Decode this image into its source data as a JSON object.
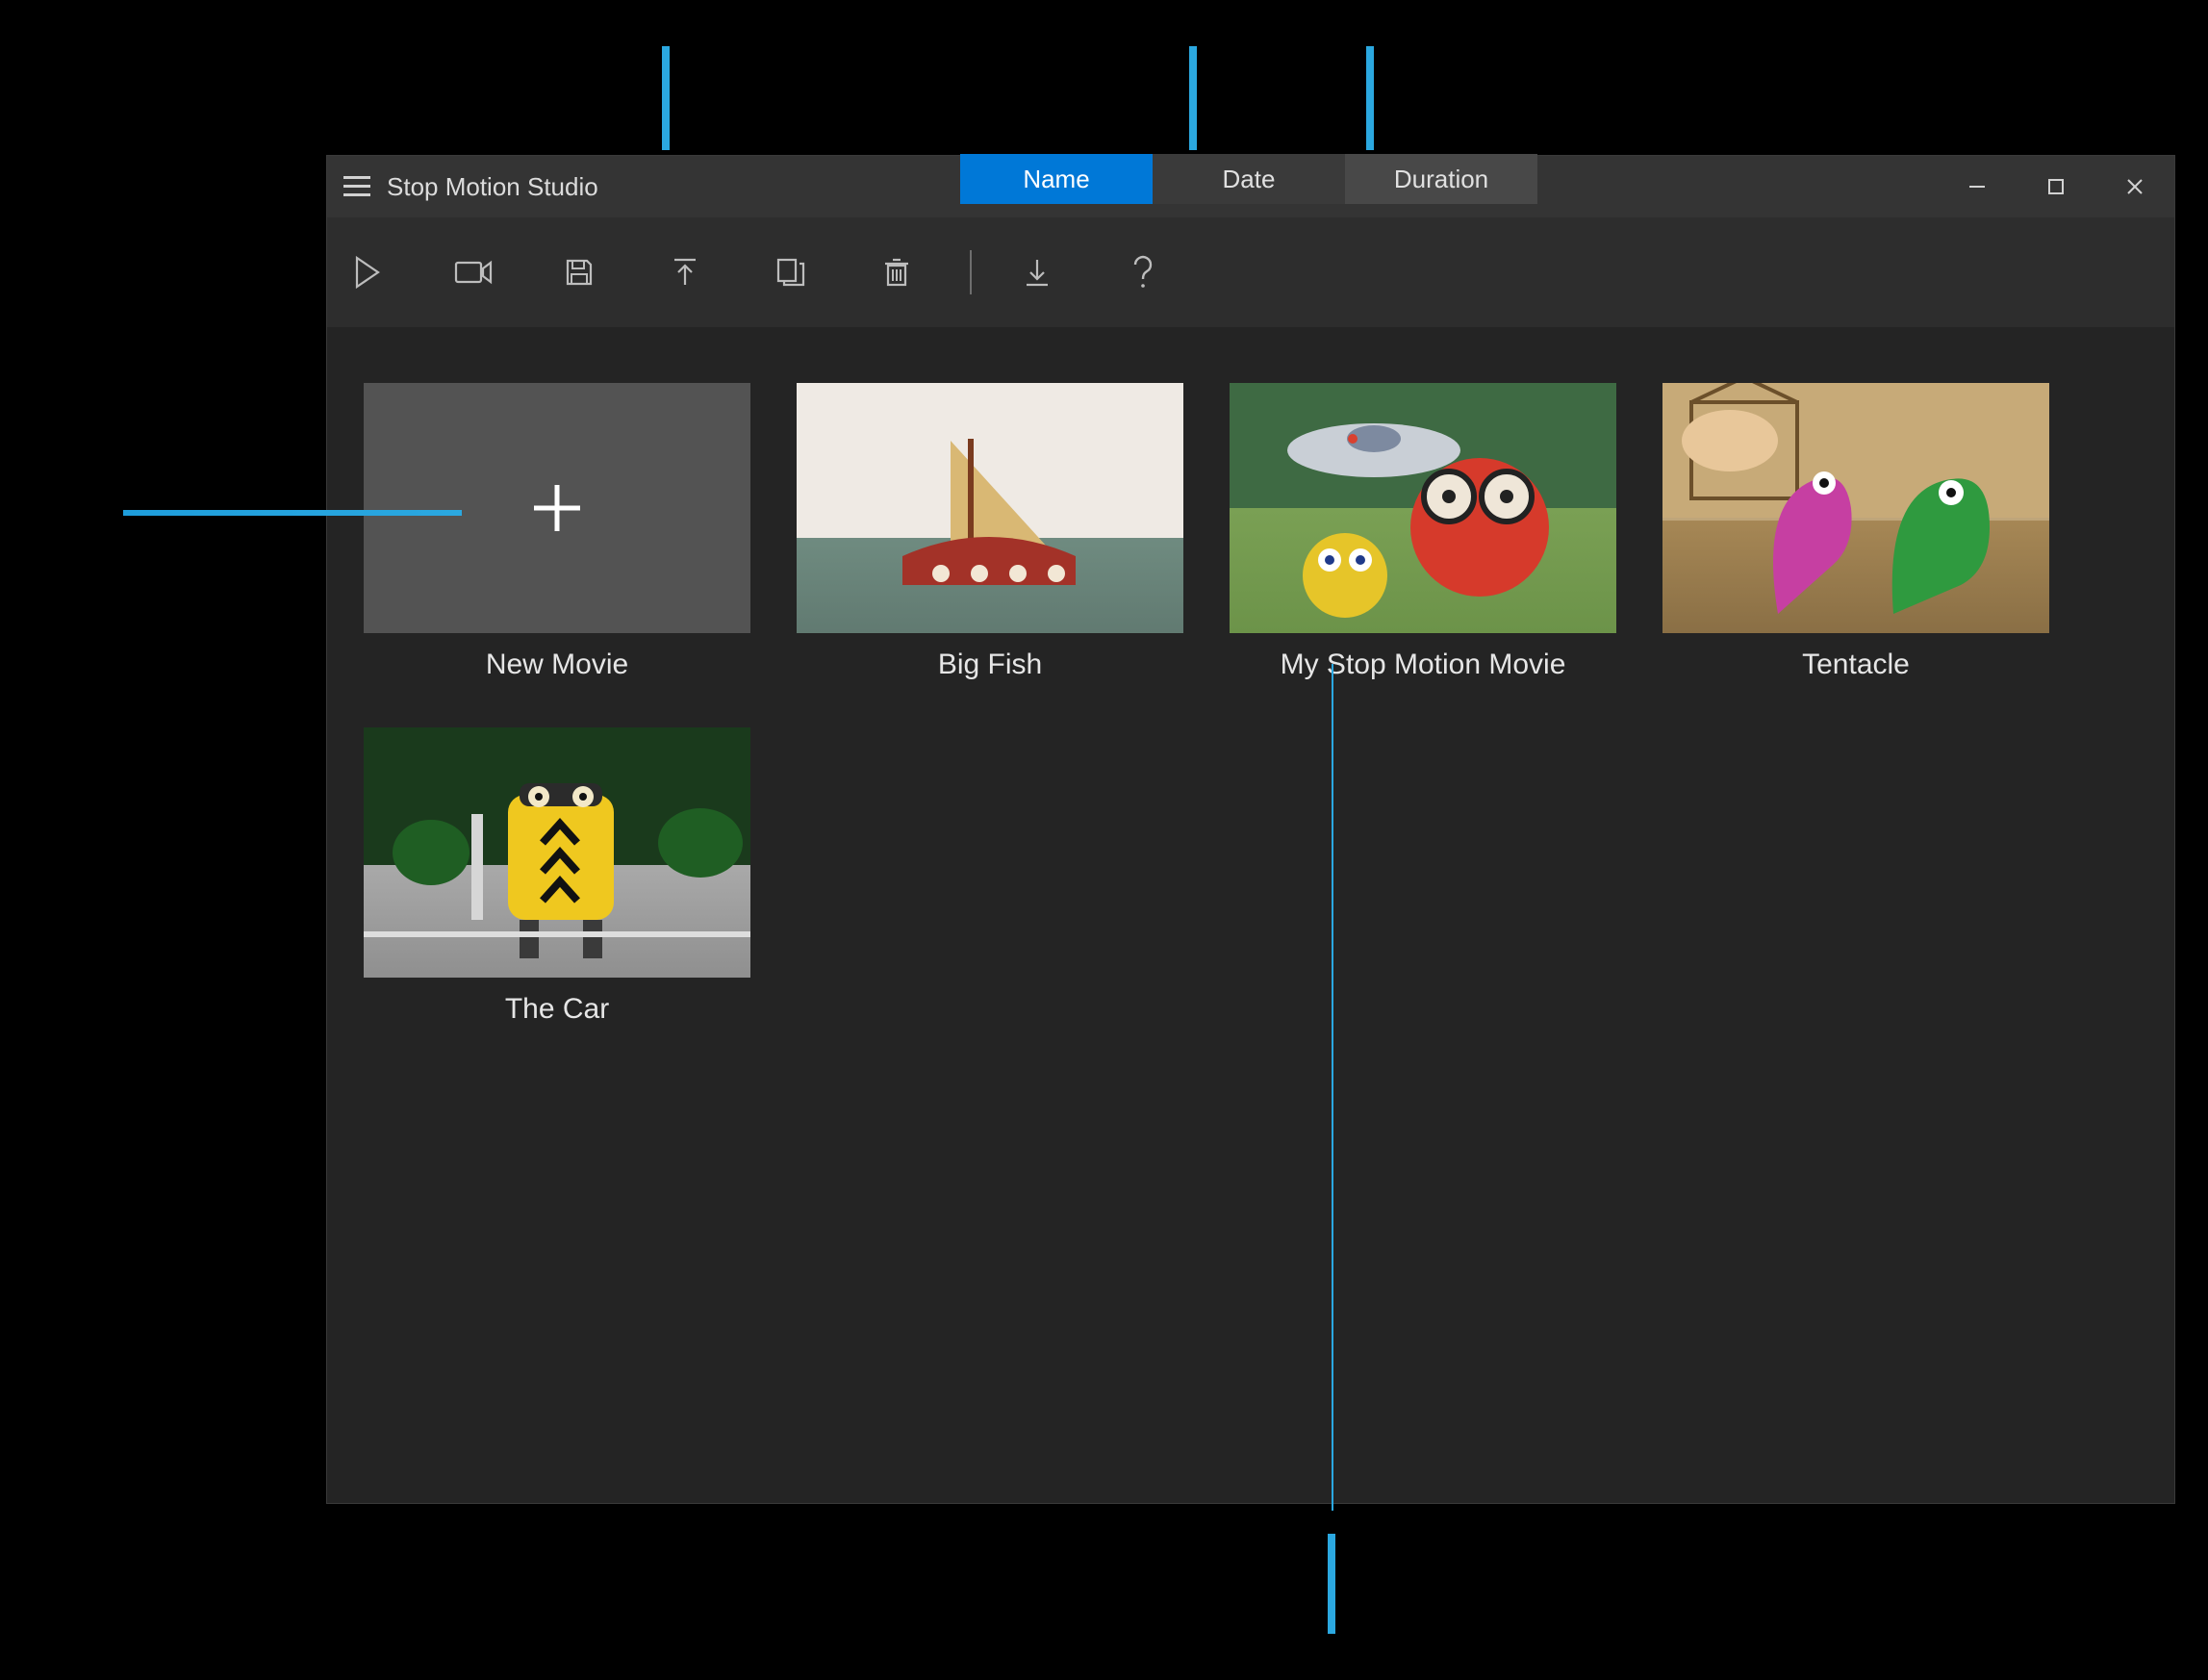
{
  "app": {
    "title": "Stop Motion Studio",
    "window_controls": {
      "minimize": "Minimize",
      "maximize": "Maximize",
      "close": "Close"
    }
  },
  "sort": {
    "tabs": [
      {
        "label": "Name",
        "active": true
      },
      {
        "label": "Date",
        "active": false
      },
      {
        "label": "Duration",
        "active": false
      }
    ]
  },
  "toolbar": {
    "items": [
      {
        "name": "play",
        "label": "Play"
      },
      {
        "name": "record",
        "label": "Record"
      },
      {
        "name": "save",
        "label": "Save"
      },
      {
        "name": "export",
        "label": "Export"
      },
      {
        "name": "copy",
        "label": "Copy"
      },
      {
        "name": "delete",
        "label": "Delete"
      },
      {
        "name": "import",
        "label": "Import"
      },
      {
        "name": "help",
        "label": "Help"
      }
    ]
  },
  "projects": [
    {
      "title": "New Movie",
      "type": "new"
    },
    {
      "title": "Big Fish",
      "type": "project"
    },
    {
      "title": "My Stop Motion Movie",
      "type": "project"
    },
    {
      "title": "Tentacle",
      "type": "project"
    },
    {
      "title": "The Car",
      "type": "project"
    }
  ]
}
